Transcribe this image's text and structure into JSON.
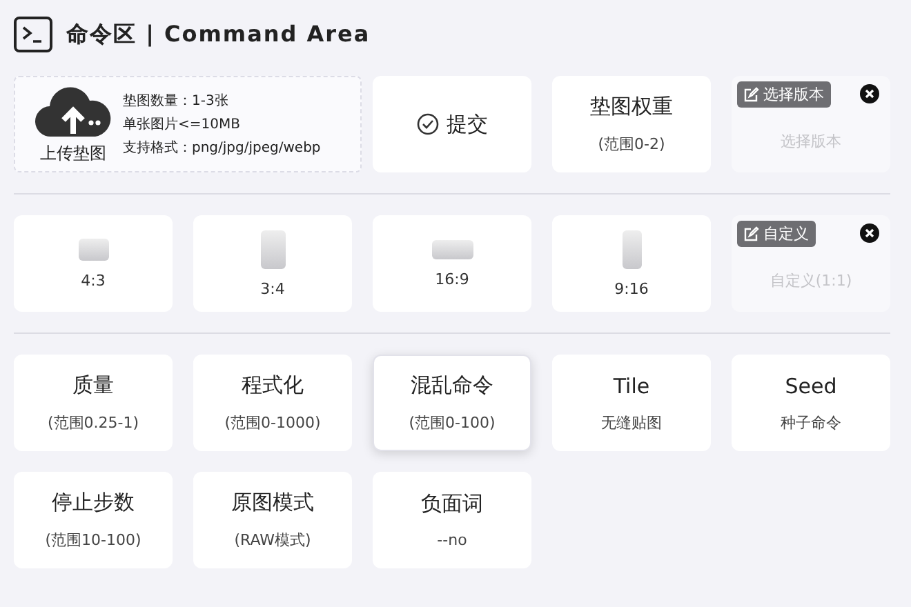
{
  "header": {
    "title": "命令区 | Command Area"
  },
  "upload": {
    "label": "上传垫图",
    "notes": [
      "垫图数量：1-3张",
      "单张图片<=10MB",
      "支持格式：png/jpg/jpeg/webp"
    ]
  },
  "submit": {
    "label": "提交"
  },
  "weight": {
    "title": "垫图权重",
    "subtitle": "(范围0-2)"
  },
  "version": {
    "badge": "选择版本",
    "subtitle": "选择版本",
    "disabled": true
  },
  "ratios": [
    {
      "label": "4:3",
      "kind": "landscape"
    },
    {
      "label": "3:4",
      "kind": "portrait"
    },
    {
      "label": "16:9",
      "kind": "wide"
    },
    {
      "label": "9:16",
      "kind": "tall"
    }
  ],
  "custom_ratio": {
    "badge": "自定义",
    "subtitle": "自定义(1:1)",
    "disabled": true
  },
  "params": [
    {
      "title": "质量",
      "subtitle": "(范围0.25-1)",
      "selected": false
    },
    {
      "title": "程式化",
      "subtitle": "(范围0-1000)",
      "selected": false
    },
    {
      "title": "混乱命令",
      "subtitle": "(范围0-100)",
      "selected": true
    },
    {
      "title": "Tile",
      "subtitle": "无缝贴图",
      "selected": false
    },
    {
      "title": "Seed",
      "subtitle": "种子命令",
      "selected": false
    },
    {
      "title": "停止步数",
      "subtitle": "(范围10-100)",
      "selected": false
    },
    {
      "title": "原图模式",
      "subtitle": "(RAW模式)",
      "selected": false
    },
    {
      "title": "负面词",
      "subtitle": "--no",
      "selected": false
    }
  ]
}
